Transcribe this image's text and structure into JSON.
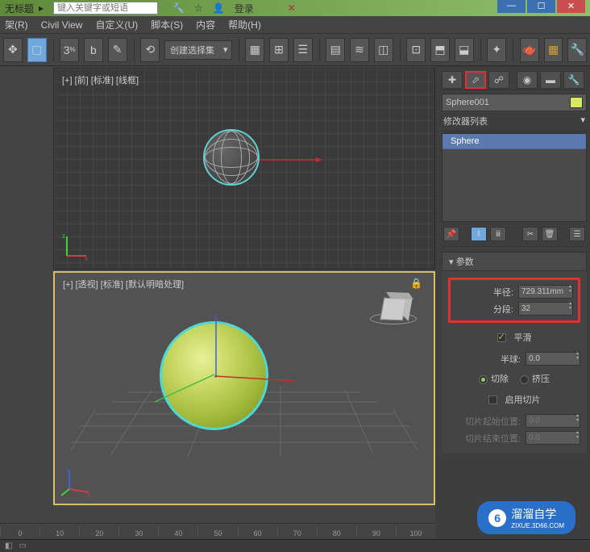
{
  "title": "无标题",
  "search_placeholder": "键入关键字或短语",
  "login_label": "登录",
  "menu": {
    "r": "架(R)",
    "civil": "Civil View",
    "custom": "自定义(U)",
    "script": "脚本(S)",
    "content": "内容",
    "help": "帮助(H)"
  },
  "toolbar": {
    "sel_set": "创建选择集",
    "angle": "3"
  },
  "viewports": {
    "front": "[+] [前] [标准] [线框]",
    "persp": "[+] [透视] [标准] [默认明暗处理]"
  },
  "panel": {
    "object_name": "Sphere001",
    "mod_list_label": "修改器列表",
    "stack_item": "Sphere",
    "rollout_title": "参数",
    "radius_label": "半径:",
    "radius_value": "729.311mm",
    "segs_label": "分段:",
    "segs_value": "32",
    "smooth_label": "平滑",
    "hemi_label": "半球:",
    "hemi_value": "0.0",
    "chop_label": "切除",
    "squash_label": "挤压",
    "slice_on_label": "启用切片",
    "slice_from_label": "切片起始位置:",
    "slice_from_value": "0.0",
    "slice_to_label": "切片结束位置:",
    "slice_to_value": "0.0"
  },
  "timeline": [
    "0",
    "10",
    "20",
    "30",
    "40",
    "50",
    "60",
    "70",
    "80",
    "90",
    "100"
  ],
  "watermark": {
    "brand": "溜溜自学",
    "url": "ZIXUE.3D66.COM"
  }
}
